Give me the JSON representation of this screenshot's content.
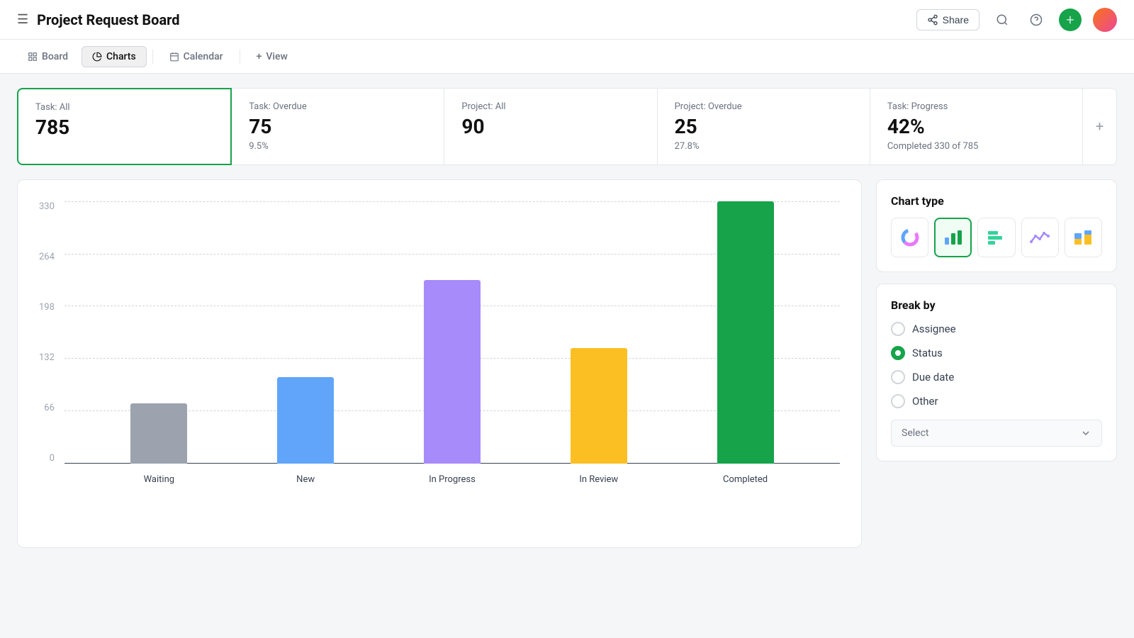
{
  "header": {
    "title": "Project Request Board",
    "share_label": "Share"
  },
  "tabs": [
    {
      "id": "board",
      "label": "Board",
      "active": false
    },
    {
      "id": "charts",
      "label": "Charts",
      "active": true
    },
    {
      "id": "calendar",
      "label": "Calendar",
      "active": false
    },
    {
      "id": "view",
      "label": "View",
      "active": false
    }
  ],
  "summary_cards": [
    {
      "label": "Task: All",
      "value": "785",
      "sub": "",
      "selected": true
    },
    {
      "label": "Task: Overdue",
      "value": "75",
      "sub": "9.5%",
      "selected": false
    },
    {
      "label": "Project: All",
      "value": "90",
      "sub": "",
      "selected": false
    },
    {
      "label": "Project: Overdue",
      "value": "25",
      "sub": "27.8%",
      "selected": false
    },
    {
      "label": "Task: Progress",
      "value": "42%",
      "sub": "Completed 330 of 785",
      "selected": false
    }
  ],
  "chart": {
    "y_labels": [
      "330",
      "264",
      "198",
      "132",
      "66",
      "0"
    ],
    "bars": [
      {
        "label": "Waiting",
        "value": 75,
        "height_pct": 23,
        "color": "#9ca3af"
      },
      {
        "label": "New",
        "value": 110,
        "height_pct": 33,
        "color": "#60a5fa"
      },
      {
        "label": "In Progress",
        "value": 230,
        "height_pct": 70,
        "color": "#a78bfa"
      },
      {
        "label": "In Review",
        "value": 145,
        "height_pct": 44,
        "color": "#fbbf24"
      },
      {
        "label": "Completed",
        "value": 330,
        "height_pct": 100,
        "color": "#16a34a"
      }
    ]
  },
  "chart_types": [
    {
      "id": "donut",
      "icon": "🍩",
      "active": false
    },
    {
      "id": "bar",
      "icon": "📊",
      "active": true
    },
    {
      "id": "hbar",
      "icon": "📉",
      "active": false
    },
    {
      "id": "line",
      "icon": "〰",
      "active": false
    },
    {
      "id": "stacked",
      "icon": "🟨",
      "active": false
    }
  ],
  "break_by": {
    "title": "Break by",
    "options": [
      {
        "label": "Assignee",
        "checked": false
      },
      {
        "label": "Status",
        "checked": true
      },
      {
        "label": "Due date",
        "checked": false
      },
      {
        "label": "Other",
        "checked": false
      }
    ],
    "select_placeholder": "Select"
  },
  "panel_title_chart_type": "Chart type"
}
